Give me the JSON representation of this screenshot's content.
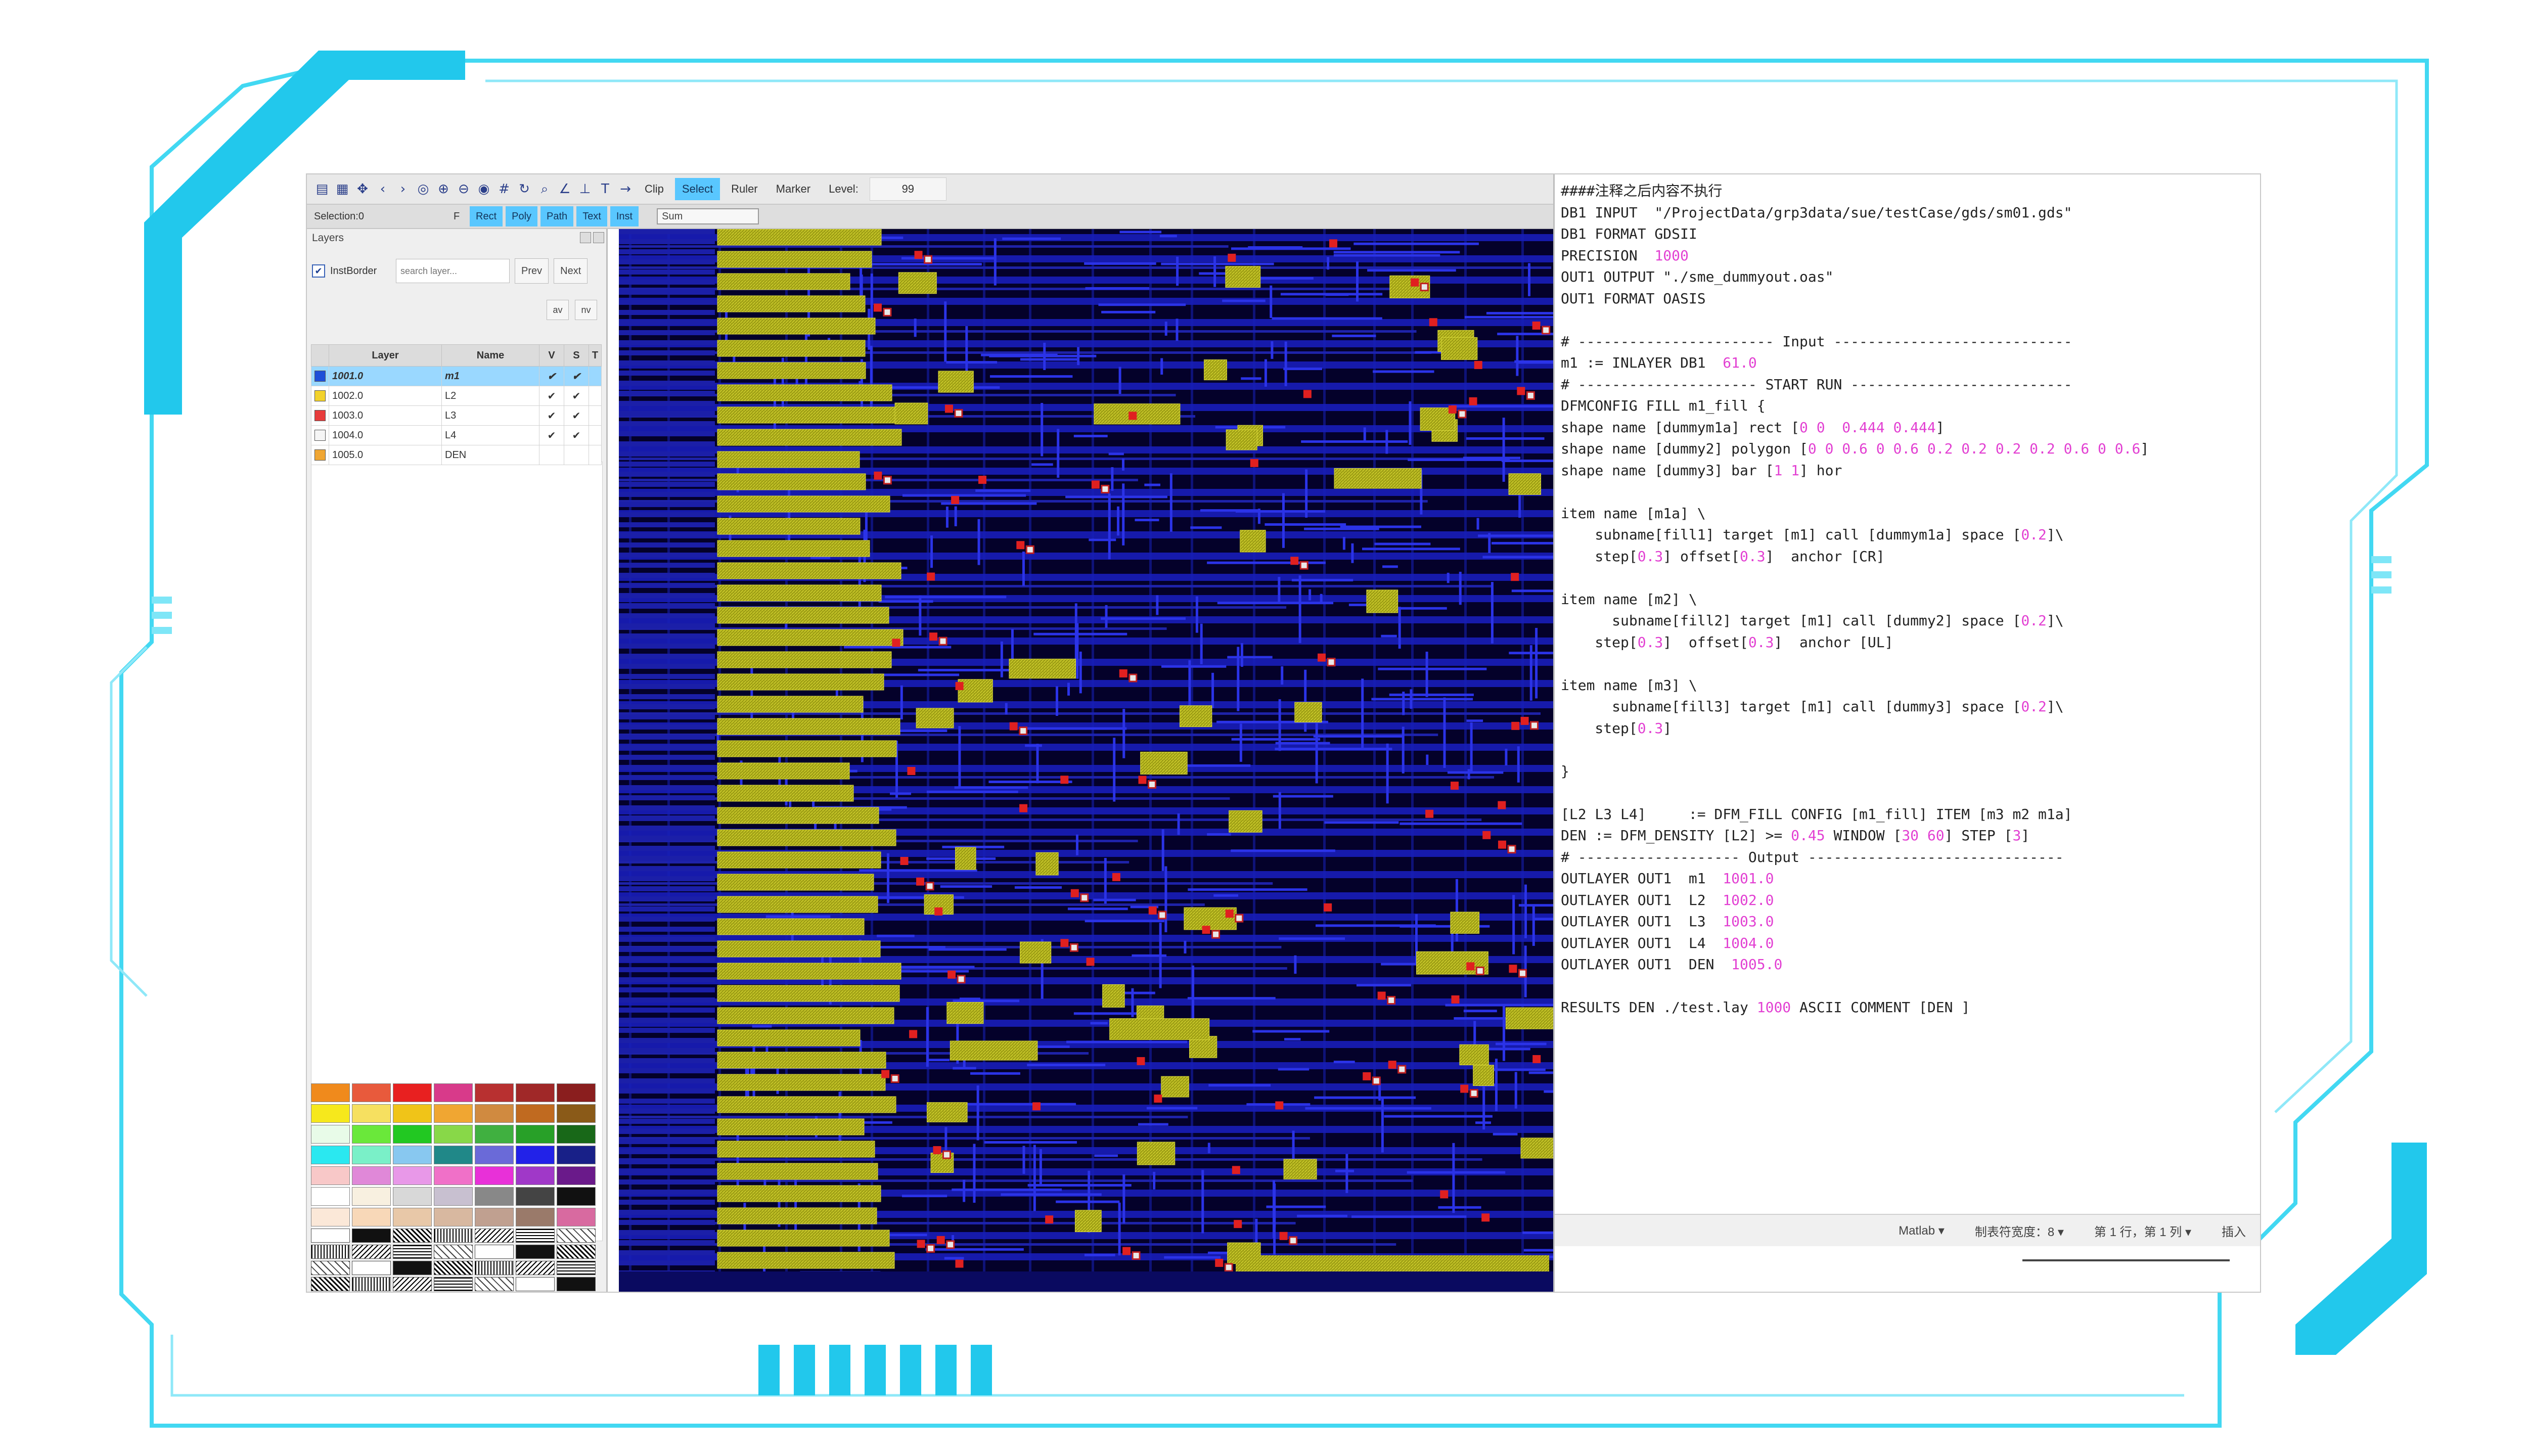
{
  "toolbar": {
    "icons": [
      "file-icon",
      "grid-icon",
      "move-icon",
      "back-icon",
      "forward-icon",
      "target-icon",
      "zoom-in-icon",
      "zoom-out-icon",
      "eye-icon",
      "grid-icon",
      "refresh-icon",
      "search-icon",
      "angle-icon",
      "anchor-icon",
      "text-icon",
      "arrow-icon"
    ],
    "buttons": [
      "Clip",
      "Select",
      "Ruler",
      "Marker"
    ],
    "level_label": "Level:",
    "level_value": "99"
  },
  "subbar": {
    "selection": "Selection:0",
    "f_label": "F",
    "modes": [
      "Rect",
      "Poly",
      "Path",
      "Text",
      "Inst"
    ],
    "sum_label": "Sum"
  },
  "layers_panel": {
    "title": "Layers",
    "inst_border_label": "InstBorder",
    "search_placeholder": "search layer...",
    "prev_label": "Prev",
    "next_label": "Next",
    "av_label": "av",
    "nv_label": "nv",
    "columns": [
      "Layer",
      "Name",
      "V",
      "S",
      "T"
    ],
    "rows": [
      {
        "layer": "1001.0",
        "name": "m1",
        "color": "#1f4fd8",
        "v": "✔",
        "s": "✔",
        "t": ""
      },
      {
        "layer": "1002.0",
        "name": "L2",
        "color": "#f2d22b",
        "v": "✔",
        "s": "✔",
        "t": ""
      },
      {
        "layer": "1003.0",
        "name": "L3",
        "color": "#e83c3c",
        "v": "✔",
        "s": "✔",
        "t": ""
      },
      {
        "layer": "1004.0",
        "name": "L4",
        "color": "#f5f5f5",
        "v": "✔",
        "s": "✔",
        "t": ""
      },
      {
        "layer": "1005.0",
        "name": "DEN",
        "color": "#f0a632",
        "v": "",
        "s": "",
        "t": ""
      }
    ],
    "palette": [
      [
        "#f08a1c",
        "#e85a3c",
        "#e82020",
        "#d83a8a",
        "#b83030",
        "#a02828",
        "#8a1e1e"
      ],
      [
        "#f6e81c",
        "#f6e060",
        "#f0c418",
        "#f0a632",
        "#d08a40",
        "#c06a20",
        "#8a5a18"
      ],
      [
        "#e8fbe8",
        "#6ae83a",
        "#22c822",
        "#88d848",
        "#40b040",
        "#28a028",
        "#186818"
      ],
      [
        "#2ae8f0",
        "#7af0c8",
        "#88c8f0",
        "#208888",
        "#6a6ad8",
        "#2222e8",
        "#182088"
      ],
      [
        "#f8c8c8",
        "#e088d8",
        "#e898e8",
        "#f070c8",
        "#e830d8",
        "#a038c8",
        "#6a1a8a"
      ],
      [
        "#ffffff",
        "#f8f0e0",
        "#d8d8d8",
        "#c8c0d0",
        "#888888",
        "#444444",
        "#111111"
      ],
      [
        "#fbe8d8",
        "#f8d8b8",
        "#e8c8a8",
        "#d8b8a0",
        "#c0a090",
        "#9a7a6a",
        "#d86aa0"
      ]
    ]
  },
  "editor": {
    "lines": [
      [
        {
          "t": "####注释之后内容不执行"
        }
      ],
      [
        {
          "t": "DB1 INPUT  \"/ProjectData/grp3data/sue/testCase/gds/sm01.gds\""
        }
      ],
      [
        {
          "t": "DB1 FORMAT GDSII"
        }
      ],
      [
        {
          "t": "PRECISION  "
        },
        {
          "t": "1000",
          "n": true
        }
      ],
      [
        {
          "t": "OUT1 OUTPUT \"./sme_dummyout.oas\""
        }
      ],
      [
        {
          "t": "OUT1 FORMAT OASIS"
        }
      ],
      [
        {
          "t": ""
        }
      ],
      [
        {
          "t": "# ----------------------- Input ----------------------------"
        }
      ],
      [
        {
          "t": "m1 := INLAYER DB1  "
        },
        {
          "t": "61.0",
          "n": true
        }
      ],
      [
        {
          "t": "# --------------------- START RUN --------------------------"
        }
      ],
      [
        {
          "t": "DFMCONFIG FILL m1_fill {"
        }
      ],
      [
        {
          "t": "shape name [dummym1a] rect ["
        },
        {
          "t": "0 0  0.444 0.444",
          "n": true
        },
        {
          "t": "]"
        }
      ],
      [
        {
          "t": "shape name [dummy2] polygon ["
        },
        {
          "t": "0 0 0.6 0 0.6 0.2 0.2 0.2 0.2 0.6 0 0.6",
          "n": true
        },
        {
          "t": "]"
        }
      ],
      [
        {
          "t": "shape name [dummy3] bar ["
        },
        {
          "t": "1 1",
          "n": true
        },
        {
          "t": "] hor"
        }
      ],
      [
        {
          "t": ""
        }
      ],
      [
        {
          "t": "item name [m1a] \\"
        }
      ],
      [
        {
          "t": "    subname[fill1] target [m1] call [dummym1a] space ["
        },
        {
          "t": "0.2",
          "n": true
        },
        {
          "t": "]\\"
        }
      ],
      [
        {
          "t": "    step["
        },
        {
          "t": "0.3",
          "n": true
        },
        {
          "t": "] offset["
        },
        {
          "t": "0.3",
          "n": true
        },
        {
          "t": "]  anchor [CR]"
        }
      ],
      [
        {
          "t": ""
        }
      ],
      [
        {
          "t": "item name [m2] \\"
        }
      ],
      [
        {
          "t": "      subname[fill2] target [m1] call [dummy2] space ["
        },
        {
          "t": "0.2",
          "n": true
        },
        {
          "t": "]\\"
        }
      ],
      [
        {
          "t": "    step["
        },
        {
          "t": "0.3",
          "n": true
        },
        {
          "t": "]  offset["
        },
        {
          "t": "0.3",
          "n": true
        },
        {
          "t": "]  anchor [UL]"
        }
      ],
      [
        {
          "t": ""
        }
      ],
      [
        {
          "t": "item name [m3] \\"
        }
      ],
      [
        {
          "t": "      subname[fill3] target [m1] call [dummy3] space ["
        },
        {
          "t": "0.2",
          "n": true
        },
        {
          "t": "]\\"
        }
      ],
      [
        {
          "t": "    step["
        },
        {
          "t": "0.3",
          "n": true
        },
        {
          "t": "]"
        }
      ],
      [
        {
          "t": ""
        }
      ],
      [
        {
          "t": "}"
        }
      ],
      [
        {
          "t": ""
        }
      ],
      [
        {
          "t": "[L2 L3 L4]     := DFM_FILL CONFIG [m1_fill] ITEM [m3 m2 m1a]"
        }
      ],
      [
        {
          "t": "DEN := DFM_DENSITY [L2] >= "
        },
        {
          "t": "0.45",
          "n": true
        },
        {
          "t": " WINDOW ["
        },
        {
          "t": "30 60",
          "n": true
        },
        {
          "t": "] STEP ["
        },
        {
          "t": "3",
          "n": true
        },
        {
          "t": "]"
        }
      ],
      [
        {
          "t": "# ------------------- Output ------------------------------"
        }
      ],
      [
        {
          "t": "OUTLAYER OUT1  m1  "
        },
        {
          "t": "1001.0",
          "n": true
        }
      ],
      [
        {
          "t": "OUTLAYER OUT1  L2  "
        },
        {
          "t": "1002.0",
          "n": true
        }
      ],
      [
        {
          "t": "OUTLAYER OUT1  L3  "
        },
        {
          "t": "1003.0",
          "n": true
        }
      ],
      [
        {
          "t": "OUTLAYER OUT1  L4  "
        },
        {
          "t": "1004.0",
          "n": true
        }
      ],
      [
        {
          "t": "OUTLAYER OUT1  DEN  "
        },
        {
          "t": "1005.0",
          "n": true
        }
      ],
      [
        {
          "t": ""
        }
      ],
      [
        {
          "t": "RESULTS DEN ./test.lay "
        },
        {
          "t": "1000",
          "n": true
        },
        {
          "t": " ASCII COMMENT [DEN ]"
        }
      ]
    ],
    "status": {
      "language": "Matlab ▾",
      "tab_width": "制表符宽度：8 ▾",
      "position": "第 1 行，第 1 列  ▾",
      "mode": "插入"
    }
  },
  "colors": {
    "frame_cyan": "#39d4f0",
    "canvas_bg": "#04012a",
    "metal_blue": "#1a1ec2",
    "fill_yellow": "#b8b81a",
    "marker_red": "#e02020"
  }
}
